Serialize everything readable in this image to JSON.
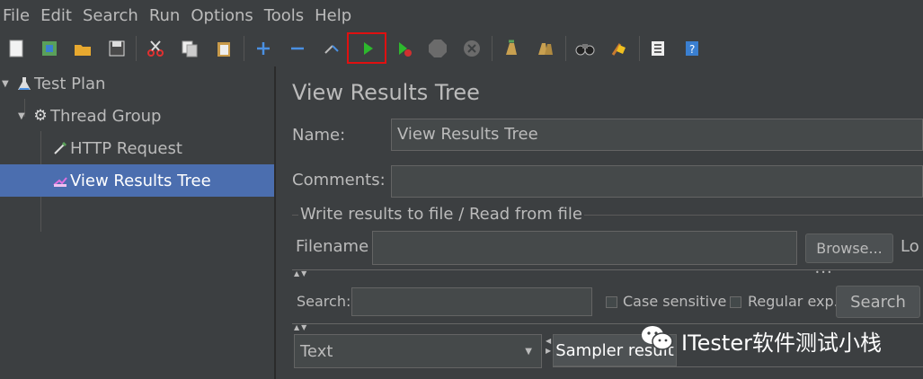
{
  "menu": [
    "File",
    "Edit",
    "Search",
    "Run",
    "Options",
    "Tools",
    "Help"
  ],
  "toolbar": {
    "icons": [
      "new-icon",
      "templates-icon",
      "open-icon",
      "save-icon",
      "cut-icon",
      "copy-icon",
      "paste-icon",
      "expand-icon",
      "collapse-icon",
      "toggle-icon",
      "start-icon",
      "start-no-pauses-icon",
      "stop-icon",
      "shutdown-icon",
      "clear-icon",
      "clear-all-icon",
      "search-icon",
      "reset-search-icon",
      "function-helper-icon",
      "help-icon"
    ]
  },
  "tree": {
    "items": [
      {
        "label": "Test Plan"
      },
      {
        "label": "Thread Group"
      },
      {
        "label": "HTTP Request"
      },
      {
        "label": "View Results Tree"
      }
    ]
  },
  "panel": {
    "title": "View Results Tree",
    "name_label": "Name:",
    "name_value": "View Results Tree",
    "comments_label": "Comments:",
    "comments_value": "",
    "file_section": "Write results to file / Read from file",
    "filename_label": "Filename",
    "filename_value": "",
    "browse_label": "Browse...",
    "log_label": "Lo",
    "search_label": "Search:",
    "search_value": "",
    "case_sensitive": "Case sensitive",
    "regular_exp": "Regular exp.",
    "search_button": "Search",
    "renderer_value": "Text",
    "sampler_tab": "Sampler result"
  },
  "watermark": "ITester软件测试小栈",
  "colors": {
    "selection": "#4b6eaf",
    "highlight": "#e01010",
    "background": "#3c3f41"
  }
}
